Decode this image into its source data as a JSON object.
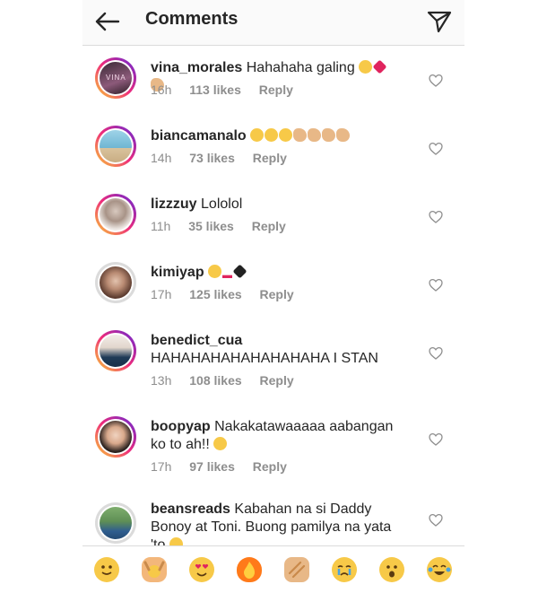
{
  "header": {
    "title": "Comments",
    "back_icon": "back-arrow-icon",
    "send_icon": "paper-plane-icon"
  },
  "comments": [
    {
      "username": "vina_morales",
      "text": "Hahahaha galing",
      "time": "16h",
      "likes": "113 likes",
      "reply": "Reply",
      "avatar_text": "VINA"
    },
    {
      "username": "biancamanalo",
      "text": "",
      "time": "14h",
      "likes": "73 likes",
      "reply": "Reply"
    },
    {
      "username": "lizzzuy",
      "text": "Lololol",
      "time": "11h",
      "likes": "35 likes",
      "reply": "Reply"
    },
    {
      "username": "kimiyap",
      "text": "",
      "time": "17h",
      "likes": "125 likes",
      "reply": "Reply"
    },
    {
      "username": "benedict_cua",
      "text": "HAHAHAHAHAHAHAHAHA I STAN",
      "time": "13h",
      "likes": "108 likes",
      "reply": "Reply"
    },
    {
      "username": "boopyap",
      "text": "Nakakatawaaaaa aabangan ko to ah!!",
      "time": "17h",
      "likes": "97 likes",
      "reply": "Reply"
    },
    {
      "username": "beansreads",
      "text": "Kabahan na si Daddy Bonoy at Toni. Buong pamilya na yata 'to",
      "time": "",
      "likes": "",
      "reply": ""
    }
  ],
  "quick_emojis": [
    "slightly-smiling-face",
    "raising-hands",
    "heart-eyes",
    "fire",
    "clapping-hands",
    "crying-face",
    "surprised-face",
    "tears-of-joy"
  ],
  "colors": {
    "text": "#262626",
    "meta": "#8e8e8e",
    "divider": "#dbdbdb",
    "story_ring_start": "#f9ce34",
    "story_ring_end": "#6228d7"
  }
}
